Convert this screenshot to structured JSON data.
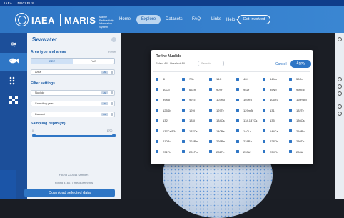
{
  "topstrip": [
    "IAEA",
    "NUCLEUS"
  ],
  "brand": {
    "iaea": "IAEA",
    "maris": "MARIS",
    "sub": "Marine Radioactivity Information System"
  },
  "nav": {
    "home": "Home",
    "explore": "Explore",
    "datasets": "Datasets",
    "faq": "FAQ",
    "links": "Links",
    "help": "Help ▾",
    "cta": "Get Involved"
  },
  "colors": {
    "primary": "#2f76c5",
    "header": "#2f76c5",
    "rail": "#1c4f9a",
    "map_bg": "#1b1e25"
  },
  "rail_icons": [
    "waves-icon",
    "fish-icon",
    "grid-dots-icon",
    "checker-icon"
  ],
  "panel": {
    "title": "Seawater",
    "area_label": "Area type and areas",
    "reset": "Reset",
    "segments": [
      "EEZ",
      "FAO"
    ],
    "area_field": "Area",
    "filter_label": "Filter settings",
    "filters": [
      {
        "label": "Nuclide",
        "tag": "All"
      },
      {
        "label": "Sampling year",
        "tag": "All"
      },
      {
        "label": "Dataset",
        "tag": "All"
      }
    ],
    "depth_label": "Sampling depth (m)",
    "depth_min": "0",
    "depth_max": "8700",
    "found_samples": "Found 220044 samples",
    "found_measurements": "Found 416077 measurements",
    "download": "Download selected data"
  },
  "modal": {
    "title": "Refine Nuclide",
    "select_all": "Select All",
    "unselect_all": "Unselect All",
    "search_placeholder": "Search...",
    "cancel": "Cancel",
    "apply": "Apply",
    "rows": [
      [
        "3H",
        "7Be",
        "14C",
        "40K",
        "54Mn",
        "58Co"
      ],
      [
        "60Co",
        "65Zn",
        "90Sr",
        "95Zr",
        "95Nb",
        "99mTc"
      ],
      [
        "99Mo",
        "99Tc",
        "103Ru",
        "103Ru",
        "106Ru",
        "110mAg"
      ],
      [
        "125Sb",
        "129I",
        "129Te",
        "129mTe",
        "131I",
        "132Te"
      ],
      [
        "132I",
        "133I",
        "134Cs",
        "134,137Cs",
        "135I",
        "136Cs"
      ],
      [
        "137Cs/134",
        "137Cs",
        "140Ba",
        "140La",
        "144Ce",
        "210Pb"
      ],
      [
        "210Po",
        "224Ra",
        "226Ra",
        "228Ra",
        "228Th",
        "230Th"
      ],
      [
        "231Th",
        "231Pa",
        "232Th",
        "233U",
        "234Th",
        "234U"
      ]
    ]
  }
}
